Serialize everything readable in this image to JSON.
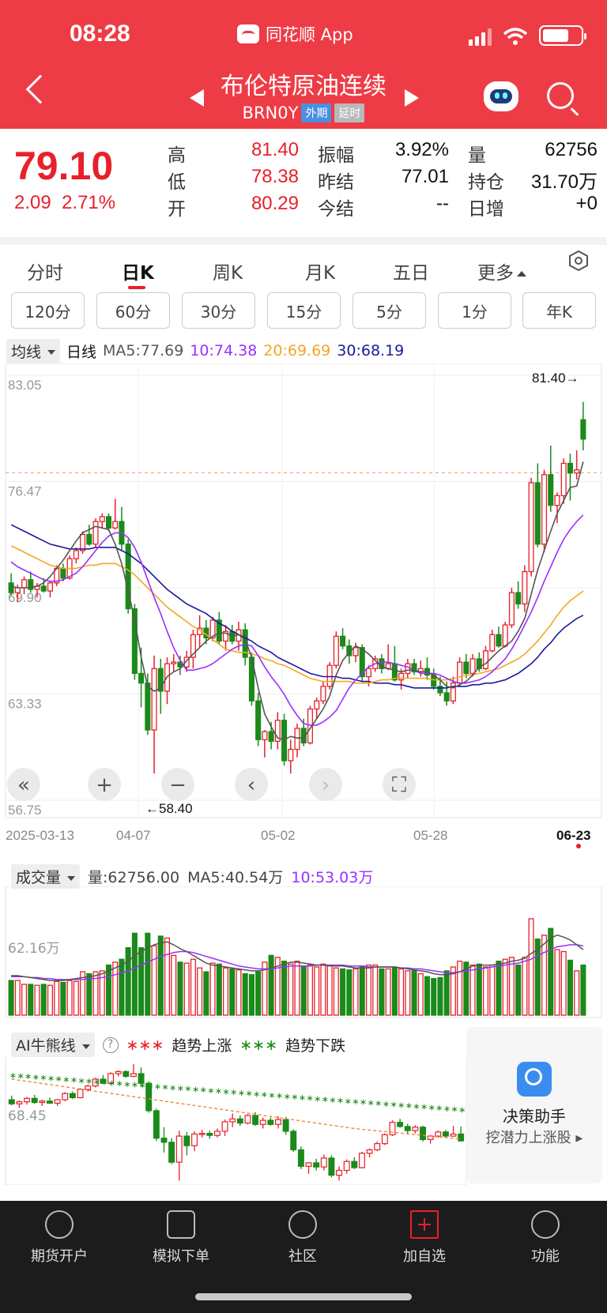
{
  "status": {
    "time": "08:28",
    "app_label": "同花顺 App"
  },
  "header": {
    "title": "布伦特原油连续",
    "code": "BRN0Y",
    "tag_market": "外期",
    "tag_delay": "延时"
  },
  "quote": {
    "price": "79.10",
    "change": "2.09",
    "change_pct": "2.71%",
    "fields": [
      {
        "label": "高",
        "value": "81.40",
        "color": "red"
      },
      {
        "label": "低",
        "value": "78.38",
        "color": "red"
      },
      {
        "label": "开",
        "value": "80.29",
        "color": "red"
      },
      {
        "label": "振幅",
        "value": "3.92%",
        "color": "black"
      },
      {
        "label": "昨结",
        "value": "77.01",
        "color": "black"
      },
      {
        "label": "今结",
        "value": "--",
        "color": "black"
      },
      {
        "label": "量",
        "value": "62756",
        "color": "black"
      },
      {
        "label": "持仓",
        "value": "31.70万",
        "color": "black"
      },
      {
        "label": "日增",
        "value": "+0",
        "color": "black"
      }
    ]
  },
  "tabs": [
    "分时",
    "日K",
    "周K",
    "月K",
    "五日",
    "更多"
  ],
  "periods": [
    "120分",
    "60分",
    "30分",
    "15分",
    "5分",
    "1分",
    "年K"
  ],
  "kline_legend": {
    "dropdown": "均线",
    "period": "日线",
    "ma5": "MA5:77.69",
    "ma10": "10:74.38",
    "ma20": "20:69.69",
    "ma30": "30:68.19"
  },
  "colors": {
    "up": "#e8202a",
    "down": "#1a8a1a",
    "ma5": "#555555",
    "ma10": "#9b30ff",
    "ma20": "#f5a623",
    "ma30": "#1a1aa0",
    "header": "#ee3c46"
  },
  "chart_data": [
    {
      "type": "candlestick",
      "y_ticks": [
        "83.05",
        "76.47",
        "69.90",
        "63.33",
        "56.75"
      ],
      "ylim": [
        56.75,
        83.05
      ],
      "x_ticks": [
        "2025-03-13",
        "04-07",
        "05-02",
        "05-28",
        "06-23"
      ],
      "max_label": "81.40→",
      "min_label": "←58.40",
      "candles": [
        [
          70.2,
          70.8,
          69.4,
          69.6
        ],
        [
          69.6,
          70.1,
          69.0,
          69.9
        ],
        [
          69.9,
          70.6,
          69.5,
          70.4
        ],
        [
          70.4,
          70.9,
          69.6,
          69.8
        ],
        [
          69.8,
          70.2,
          69.3,
          70.0
        ],
        [
          70.0,
          70.5,
          69.6,
          69.7
        ],
        [
          69.7,
          70.3,
          69.3,
          70.2
        ],
        [
          70.2,
          71.3,
          70.0,
          71.1
        ],
        [
          71.1,
          71.4,
          70.3,
          70.5
        ],
        [
          70.5,
          71.9,
          70.4,
          71.7
        ],
        [
          71.7,
          72.4,
          71.4,
          72.2
        ],
        [
          72.2,
          73.4,
          72.0,
          73.2
        ],
        [
          73.2,
          73.8,
          72.5,
          72.6
        ],
        [
          72.6,
          74.2,
          72.4,
          74.0
        ],
        [
          74.0,
          74.5,
          73.6,
          74.3
        ],
        [
          74.3,
          74.5,
          73.4,
          73.6
        ],
        [
          73.6,
          75.4,
          73.5,
          74.0
        ],
        [
          74.0,
          74.9,
          72.2,
          72.6
        ],
        [
          72.6,
          72.9,
          68.3,
          68.6
        ],
        [
          68.6,
          68.9,
          64.2,
          64.6
        ],
        [
          64.6,
          66.2,
          62.5,
          64.0
        ],
        [
          64.0,
          64.6,
          60.8,
          61.1
        ],
        [
          61.1,
          65.7,
          58.4,
          64.9
        ],
        [
          64.9,
          65.5,
          62.1,
          63.5
        ],
        [
          63.5,
          65.6,
          62.7,
          65.2
        ],
        [
          65.2,
          65.8,
          64.7,
          65.3
        ],
        [
          65.3,
          65.7,
          64.5,
          65.0
        ],
        [
          65.0,
          66.0,
          64.7,
          65.6
        ],
        [
          65.6,
          67.3,
          64.9,
          67.0
        ],
        [
          67.0,
          68.2,
          66.2,
          67.4
        ],
        [
          67.4,
          67.9,
          66.4,
          66.8
        ],
        [
          66.8,
          68.1,
          66.6,
          67.9
        ],
        [
          67.9,
          68.4,
          66.4,
          66.6
        ],
        [
          66.6,
          67.6,
          66.0,
          67.2
        ],
        [
          67.2,
          67.6,
          66.4,
          66.6
        ],
        [
          66.6,
          67.8,
          66.0,
          67.3
        ],
        [
          67.3,
          67.7,
          65.1,
          65.6
        ],
        [
          65.6,
          65.9,
          62.6,
          62.9
        ],
        [
          62.9,
          63.4,
          60.1,
          60.5
        ],
        [
          60.5,
          61.1,
          59.4,
          61.0
        ],
        [
          61.0,
          61.6,
          59.9,
          60.4
        ],
        [
          60.4,
          62.2,
          59.9,
          61.7
        ],
        [
          61.7,
          62.1,
          58.9,
          59.2
        ],
        [
          59.2,
          60.5,
          58.4,
          59.9
        ],
        [
          59.9,
          61.5,
          59.4,
          61.2
        ],
        [
          61.2,
          61.8,
          60.1,
          60.3
        ],
        [
          60.3,
          62.6,
          60.2,
          62.4
        ],
        [
          62.4,
          63.1,
          61.8,
          62.9
        ],
        [
          62.9,
          64.1,
          62.7,
          63.8
        ],
        [
          63.8,
          65.3,
          63.6,
          65.1
        ],
        [
          65.1,
          67.2,
          64.9,
          66.9
        ],
        [
          66.9,
          67.4,
          66.1,
          66.3
        ],
        [
          66.3,
          66.7,
          65.2,
          65.7
        ],
        [
          65.7,
          66.5,
          65.3,
          66.2
        ],
        [
          66.2,
          66.4,
          64.1,
          64.4
        ],
        [
          64.4,
          65.1,
          63.8,
          64.9
        ],
        [
          64.9,
          65.7,
          64.7,
          65.5
        ],
        [
          65.5,
          65.8,
          64.6,
          64.9
        ],
        [
          64.9,
          66.4,
          64.8,
          65.2
        ],
        [
          65.2,
          66.3,
          64.1,
          64.2
        ],
        [
          64.2,
          64.9,
          63.6,
          64.6
        ],
        [
          64.6,
          65.5,
          64.3,
          65.2
        ],
        [
          65.2,
          65.5,
          64.5,
          64.7
        ],
        [
          64.7,
          65.4,
          64.4,
          64.9
        ],
        [
          64.9,
          65.6,
          64.2,
          64.5
        ],
        [
          64.5,
          64.9,
          63.6,
          63.8
        ],
        [
          63.8,
          64.4,
          63.2,
          63.4
        ],
        [
          63.4,
          64.1,
          62.6,
          62.9
        ],
        [
          62.9,
          64.4,
          62.7,
          64.0
        ],
        [
          64.0,
          65.6,
          63.8,
          65.3
        ],
        [
          65.3,
          65.8,
          64.3,
          64.6
        ],
        [
          64.6,
          65.8,
          64.4,
          65.5
        ],
        [
          65.5,
          65.9,
          64.7,
          64.9
        ],
        [
          64.9,
          66.3,
          64.8,
          66.0
        ],
        [
          66.0,
          67.3,
          65.9,
          67.0
        ],
        [
          67.0,
          67.5,
          66.2,
          66.3
        ],
        [
          66.3,
          67.8,
          66.2,
          67.6
        ],
        [
          67.6,
          69.9,
          67.4,
          69.6
        ],
        [
          69.6,
          70.3,
          68.6,
          68.9
        ],
        [
          68.9,
          71.3,
          68.4,
          70.9
        ],
        [
          70.9,
          76.7,
          70.6,
          76.4
        ],
        [
          76.4,
          77.6,
          72.4,
          72.6
        ],
        [
          72.6,
          77.2,
          72.1,
          76.9
        ],
        [
          76.9,
          78.7,
          74.6,
          75.0
        ],
        [
          75.0,
          75.8,
          73.9,
          75.6
        ],
        [
          75.6,
          77.9,
          75.1,
          77.6
        ],
        [
          77.6,
          78.2,
          75.3,
          77.0
        ],
        [
          77.0,
          78.4,
          76.6,
          77.2
        ],
        [
          80.3,
          81.4,
          78.4,
          79.1
        ]
      ],
      "ma5": [
        70.0,
        69.9,
        69.9,
        69.9,
        70.0,
        70.2,
        70.6,
        71.1,
        71.6,
        72.2,
        72.8,
        73.3,
        73.5,
        73.7,
        73.6,
        73.5,
        72.6,
        71.4,
        69.7,
        67.9,
        65.6,
        63.8,
        63.5,
        63.7,
        64.4,
        64.7,
        64.9,
        65.4,
        65.8,
        66.2,
        66.6,
        66.9,
        67.1,
        67.1,
        66.9,
        67.0,
        66.7,
        65.6,
        63.7,
        62.1,
        61.3,
        60.6,
        60.5,
        60.7,
        60.6,
        60.6,
        61.2,
        61.8,
        62.4,
        63.2,
        64.5,
        65.4,
        65.9,
        66.3,
        66.1,
        65.8,
        65.4,
        65.0,
        64.9,
        64.8,
        64.7,
        64.8,
        64.8,
        64.7,
        64.7,
        64.5,
        64.2,
        63.8,
        63.7,
        63.9,
        64.1,
        64.5,
        65.0,
        65.2,
        65.6,
        66.0,
        66.3,
        66.6,
        67.2,
        68.0,
        69.5,
        71.0,
        72.2,
        73.4,
        74.5,
        75.3,
        76.1,
        76.2,
        77.7
      ],
      "ma10": [
        71.5,
        71.2,
        71.0,
        70.8,
        70.6,
        70.4,
        70.3,
        70.3,
        70.4,
        70.6,
        70.8,
        71.2,
        71.7,
        72.2,
        72.7,
        73.1,
        73.3,
        73.3,
        73.0,
        72.4,
        71.5,
        70.4,
        69.3,
        68.3,
        67.2,
        66.2,
        65.4,
        64.8,
        64.8,
        64.9,
        65.0,
        65.2,
        65.5,
        65.8,
        66.1,
        66.3,
        66.4,
        66.3,
        65.7,
        65.0,
        64.4,
        63.9,
        63.3,
        62.6,
        62.0,
        61.5,
        61.4,
        61.4,
        61.6,
        61.9,
        62.3,
        63.0,
        63.7,
        64.2,
        64.6,
        65.0,
        65.2,
        65.3,
        65.3,
        65.2,
        65.1,
        65.0,
        64.8,
        64.6,
        64.6,
        64.6,
        64.5,
        64.3,
        64.1,
        64.0,
        64.0,
        64.1,
        64.2,
        64.4,
        64.7,
        65.1,
        65.5,
        66.1,
        66.8,
        67.6,
        68.4,
        69.3,
        70.3,
        71.2,
        72.1,
        72.9,
        73.5,
        74.0,
        74.4
      ],
      "ma20": [
        72.5,
        72.3,
        72.1,
        71.9,
        71.7,
        71.5,
        71.3,
        71.2,
        71.1,
        71.1,
        71.1,
        71.2,
        71.3,
        71.3,
        71.4,
        71.4,
        71.4,
        71.2,
        71.0,
        70.7,
        70.3,
        69.9,
        69.5,
        69.1,
        68.7,
        68.4,
        68.1,
        67.8,
        67.5,
        67.3,
        67.0,
        66.7,
        66.4,
        66.1,
        66.0,
        65.9,
        65.9,
        65.8,
        65.7,
        65.5,
        65.4,
        65.2,
        65.1,
        64.9,
        64.7,
        64.5,
        64.3,
        64.2,
        64.1,
        64.1,
        64.1,
        64.1,
        64.1,
        64.0,
        64.0,
        64.0,
        64.1,
        64.2,
        64.2,
        64.3,
        64.3,
        64.3,
        64.3,
        64.3,
        64.3,
        64.2,
        64.2,
        64.2,
        64.3,
        64.4,
        64.5,
        64.5,
        64.6,
        64.7,
        64.8,
        64.9,
        65.1,
        65.3,
        65.5,
        65.8,
        66.2,
        66.6,
        67.1,
        67.6,
        68.2,
        68.7,
        69.1,
        69.4,
        69.7
      ],
      "ma30": [
        73.8,
        73.6,
        73.4,
        73.2,
        73.0,
        72.8,
        72.6,
        72.5,
        72.4,
        72.3,
        72.3,
        72.3,
        72.3,
        72.4,
        72.4,
        72.4,
        72.4,
        72.2,
        72.0,
        71.7,
        71.4,
        71.0,
        70.6,
        70.2,
        69.8,
        69.5,
        69.2,
        68.9,
        68.7,
        68.5,
        68.3,
        68.0,
        67.7,
        67.5,
        67.2,
        67.0,
        66.8,
        66.6,
        66.3,
        66.1,
        65.9,
        65.6,
        65.4,
        65.2,
        65.0,
        64.8,
        64.6,
        64.5,
        64.4,
        64.4,
        64.4,
        64.3,
        64.3,
        64.2,
        64.1,
        64.1,
        64.0,
        64.0,
        64.0,
        63.9,
        63.9,
        63.8,
        63.7,
        63.7,
        63.7,
        63.7,
        63.7,
        63.7,
        63.8,
        63.8,
        63.8,
        63.9,
        63.9,
        64.0,
        64.0,
        64.1,
        64.2,
        64.4,
        64.6,
        64.9,
        65.2,
        65.6,
        66.1,
        66.5,
        67.0,
        67.4,
        67.7,
        68.0,
        68.2
      ]
    },
    {
      "type": "bar",
      "tick": "62.16万",
      "volumes": [
        36,
        36,
        32,
        32,
        31,
        32,
        31,
        35,
        34,
        36,
        35,
        45,
        43,
        45,
        46,
        52,
        55,
        58,
        70,
        85,
        70,
        85,
        72,
        82,
        80,
        62,
        55,
        54,
        58,
        49,
        45,
        54,
        53,
        49,
        48,
        47,
        43,
        42,
        45,
        55,
        62,
        60,
        56,
        53,
        56,
        50,
        52,
        50,
        53,
        52,
        49,
        48,
        47,
        48,
        51,
        52,
        52,
        48,
        48,
        50,
        48,
        46,
        46,
        43,
        40,
        38,
        39,
        46,
        50,
        56,
        55,
        52,
        53,
        50,
        52,
        56,
        58,
        60,
        52,
        60,
        100,
        79,
        83,
        90,
        68,
        66,
        57,
        46,
        52
      ],
      "vol_ma5": [
        41,
        41,
        40,
        39,
        38,
        37,
        36,
        36,
        36,
        37,
        38,
        39,
        40,
        41,
        43,
        46,
        49,
        52,
        56,
        62,
        66,
        70,
        73,
        75,
        76,
        73,
        69,
        66,
        62,
        58,
        54,
        52,
        51,
        50,
        49,
        48,
        47,
        46,
        46,
        47,
        49,
        51,
        53,
        55,
        55,
        54,
        53,
        52,
        52,
        51,
        51,
        51,
        50,
        49,
        49,
        49,
        50,
        50,
        50,
        50,
        49,
        48,
        47,
        46,
        45,
        43,
        42,
        42,
        43,
        45,
        48,
        51,
        52,
        52,
        52,
        53,
        54,
        56,
        57,
        59,
        64,
        68,
        74,
        80,
        83,
        81,
        78,
        73,
        68
      ],
      "vol_ma10": [
        40,
        40,
        40,
        39,
        39,
        38,
        38,
        37,
        37,
        37,
        37,
        37,
        38,
        38,
        39,
        40,
        42,
        44,
        46,
        49,
        52,
        55,
        58,
        61,
        63,
        65,
        66,
        66,
        65,
        63,
        61,
        59,
        57,
        55,
        53,
        51,
        50,
        49,
        48,
        48,
        48,
        49,
        50,
        51,
        51,
        51,
        51,
        52,
        52,
        52,
        52,
        52,
        51,
        51,
        51,
        50,
        50,
        50,
        50,
        50,
        49,
        49,
        48,
        48,
        47,
        46,
        45,
        44,
        44,
        45,
        46,
        47,
        48,
        49,
        50,
        51,
        52,
        53,
        54,
        56,
        58,
        62,
        65,
        68,
        71,
        72,
        73,
        73,
        72
      ]
    },
    {
      "type": "line",
      "tick": "68.45",
      "legend": [
        "趋势上涨",
        "趋势下跌"
      ]
    }
  ],
  "vol_legend": {
    "dropdown": "成交量",
    "volume": "量:62756.00",
    "ma5": "MA5:40.54万",
    "ma10": "10:53.03万"
  },
  "ai_legend": {
    "dropdown": "AI牛熊线",
    "help": "?",
    "up": "趋势上涨",
    "down": "趋势下跌"
  },
  "assistant": {
    "title": "决策助手",
    "subtitle": "挖潜力上涨股 ▸"
  },
  "bottom_nav": [
    "期货开户",
    "模拟下单",
    "社区",
    "加自选",
    "功能"
  ]
}
